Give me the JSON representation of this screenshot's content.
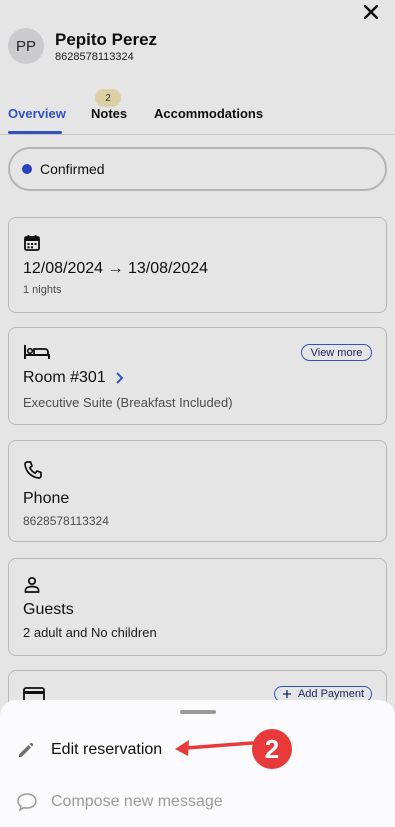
{
  "header": {
    "close_icon": "close-icon",
    "avatar_initials": "PP",
    "guest_name": "Pepito Perez",
    "guest_phone": "8628578113324"
  },
  "tabs": [
    {
      "label": "Overview",
      "active": true
    },
    {
      "label": "Notes",
      "badge": "2"
    },
    {
      "label": "Accommodations"
    }
  ],
  "status": {
    "label": "Confirmed",
    "dot_color": "#2f49d0"
  },
  "dates_card": {
    "icon": "calendar-icon",
    "range": "12/08/2024 → 13/08/2024",
    "nights": "1 nights"
  },
  "room_card": {
    "icon": "bed-icon",
    "room": "Room #301",
    "room_type": "Executive Suite (Breakfast Included)",
    "view_more_label": "View  more"
  },
  "phone_card": {
    "icon": "phone-icon",
    "title": "Phone",
    "value": "8628578113324"
  },
  "guests_card": {
    "icon": "person-icon",
    "title": "Guests",
    "value": "2 adult and No children"
  },
  "payment_card": {
    "icon": "credit-card-icon",
    "add_payment_label": "Add Payment"
  },
  "sheet": {
    "items": [
      {
        "icon": "pencil-icon",
        "label": "Edit reservation"
      },
      {
        "icon": "chat-bubble-icon",
        "label": "Compose new message"
      }
    ]
  },
  "annotation": {
    "step": "2",
    "color": "#e8393b"
  },
  "colors": {
    "accent": "#3a5bd6",
    "badge_bg": "#f6e8b8"
  }
}
